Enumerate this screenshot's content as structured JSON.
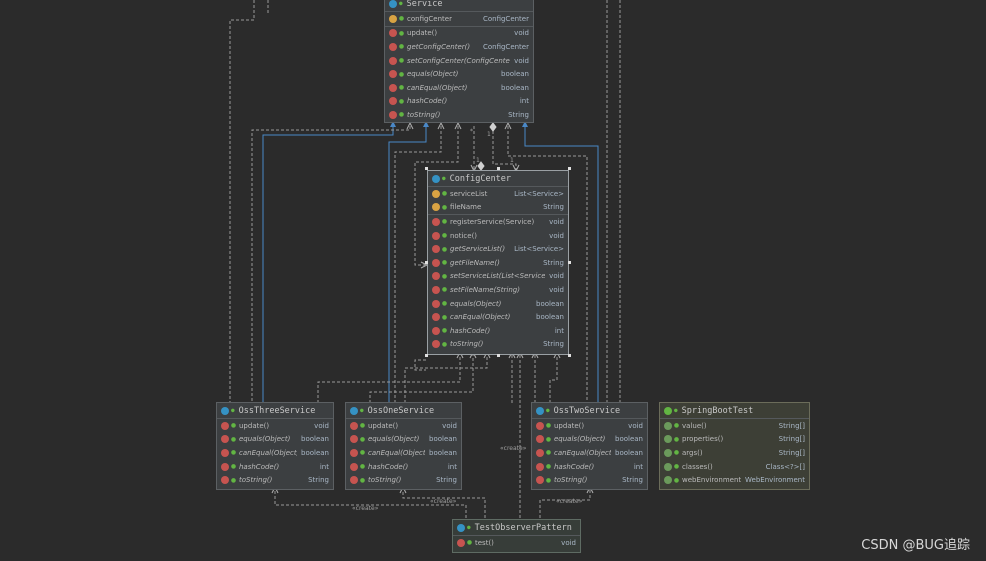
{
  "classes": {
    "service": {
      "title": "Service",
      "fields": [
        {
          "name": "configCenter",
          "type": "ConfigCenter"
        }
      ],
      "methods": [
        {
          "name": "update()",
          "type": "void",
          "italic": false
        },
        {
          "name": "getConfigCenter()",
          "type": "ConfigCenter",
          "italic": true
        },
        {
          "name": "setConfigCenter(ConfigCenter)",
          "type": "void",
          "italic": true
        },
        {
          "name": "equals(Object)",
          "type": "boolean",
          "italic": true
        },
        {
          "name": "canEqual(Object)",
          "type": "boolean",
          "italic": true
        },
        {
          "name": "hashCode()",
          "type": "int",
          "italic": true
        },
        {
          "name": "toString()",
          "type": "String",
          "italic": true
        }
      ]
    },
    "config_center": {
      "title": "ConfigCenter",
      "fields": [
        {
          "name": "serviceList",
          "type": "List<Service>"
        },
        {
          "name": "fileName",
          "type": "String"
        }
      ],
      "methods": [
        {
          "name": "registerService(Service)",
          "type": "void",
          "italic": false
        },
        {
          "name": "notice()",
          "type": "void",
          "italic": false
        },
        {
          "name": "getServiceList()",
          "type": "List<Service>",
          "italic": true
        },
        {
          "name": "getFileName()",
          "type": "String",
          "italic": true
        },
        {
          "name": "setServiceList(List<Service>)",
          "type": "void",
          "italic": true
        },
        {
          "name": "setFileName(String)",
          "type": "void",
          "italic": true
        },
        {
          "name": "equals(Object)",
          "type": "boolean",
          "italic": true
        },
        {
          "name": "canEqual(Object)",
          "type": "boolean",
          "italic": true
        },
        {
          "name": "hashCode()",
          "type": "int",
          "italic": true
        },
        {
          "name": "toString()",
          "type": "String",
          "italic": true
        }
      ]
    },
    "oss_three": {
      "title": "OssThreeService",
      "methods": [
        {
          "name": "update()",
          "type": "void",
          "italic": false
        },
        {
          "name": "equals(Object)",
          "type": "boolean",
          "italic": true
        },
        {
          "name": "canEqual(Object)",
          "type": "boolean",
          "italic": true
        },
        {
          "name": "hashCode()",
          "type": "int",
          "italic": true
        },
        {
          "name": "toString()",
          "type": "String",
          "italic": true
        }
      ]
    },
    "oss_one": {
      "title": "OssOneService",
      "methods": [
        {
          "name": "update()",
          "type": "void",
          "italic": false
        },
        {
          "name": "equals(Object)",
          "type": "boolean",
          "italic": true
        },
        {
          "name": "canEqual(Object)",
          "type": "boolean",
          "italic": true
        },
        {
          "name": "hashCode()",
          "type": "int",
          "italic": true
        },
        {
          "name": "toString()",
          "type": "String",
          "italic": true
        }
      ]
    },
    "oss_two": {
      "title": "OssTwoService",
      "methods": [
        {
          "name": "update()",
          "type": "void",
          "italic": false
        },
        {
          "name": "equals(Object)",
          "type": "boolean",
          "italic": true
        },
        {
          "name": "canEqual(Object)",
          "type": "boolean",
          "italic": true
        },
        {
          "name": "hashCode()",
          "type": "int",
          "italic": true
        },
        {
          "name": "toString()",
          "type": "String",
          "italic": true
        }
      ]
    },
    "spring_boot_test": {
      "title": "SpringBootTest",
      "methods": [
        {
          "name": "value()",
          "type": "String[]",
          "italic": false
        },
        {
          "name": "properties()",
          "type": "String[]",
          "italic": false
        },
        {
          "name": "args()",
          "type": "String[]",
          "italic": false
        },
        {
          "name": "classes()",
          "type": "Class<?>[]",
          "italic": false
        },
        {
          "name": "webEnvironment()",
          "type": "WebEnvironment",
          "italic": false
        }
      ]
    },
    "test_observer": {
      "title": "TestObserverPattern",
      "methods": [
        {
          "name": "test()",
          "type": "void",
          "italic": false
        }
      ]
    }
  },
  "edge_labels": {
    "create": "«create»",
    "multiplicity_many": "*",
    "multiplicity_one": "1"
  },
  "watermark": "CSDN @BUG追踪",
  "colors": {
    "background": "#2b2b2b",
    "node": "#3c3f41",
    "inheritance": "#4a88c7",
    "dependency": "#9a9a9a"
  }
}
